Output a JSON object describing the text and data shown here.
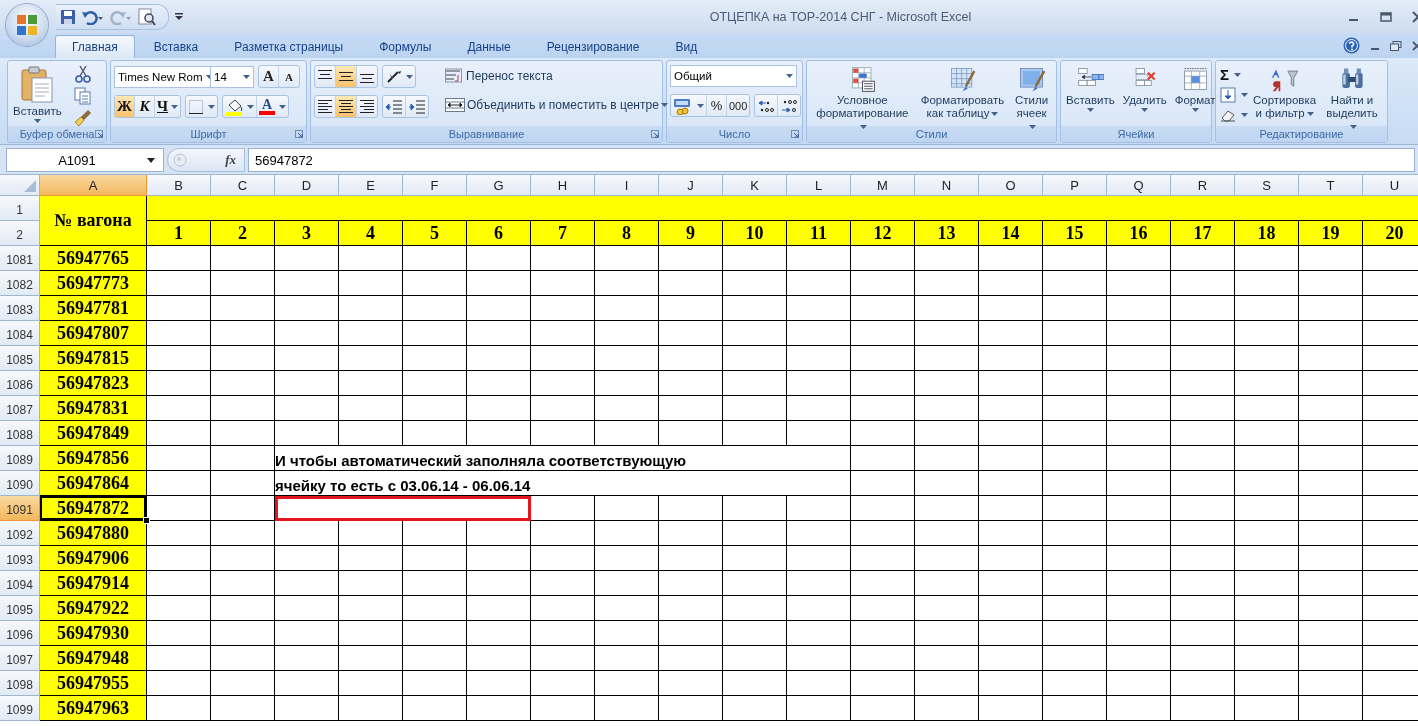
{
  "window": {
    "title": "ОТЦЕПКА на ТОР-2014 СНГ - Microsoft Excel"
  },
  "tabs": [
    {
      "label": "Главная",
      "selected": true
    },
    {
      "label": "Вставка",
      "selected": false
    },
    {
      "label": "Разметка страницы",
      "selected": false
    },
    {
      "label": "Формулы",
      "selected": false
    },
    {
      "label": "Данные",
      "selected": false
    },
    {
      "label": "Рецензирование",
      "selected": false
    },
    {
      "label": "Вид",
      "selected": false
    }
  ],
  "ribbon": {
    "groups": [
      {
        "kind": "clipboard",
        "label": "Буфер обмена",
        "paste": "Вставить"
      },
      {
        "kind": "font",
        "label": "Шрифт",
        "font_name": "Times New Rom",
        "font_size": "14",
        "grow": "A",
        "shrink": "A",
        "font_color_letter": "A",
        "styles": [
          {
            "kind": "bold",
            "text": "Ж",
            "pressed": true
          },
          {
            "kind": "italic",
            "text": "К",
            "pressed": false
          },
          {
            "kind": "underline",
            "text": "Ч",
            "pressed": false
          }
        ]
      },
      {
        "kind": "alignment",
        "label": "Выравнивание",
        "wrap_text": "Перенос текста",
        "merge": "Объединить и поместить в центре",
        "vertical": [
          {
            "kind": "top",
            "pressed": false
          },
          {
            "kind": "middle",
            "pressed": true
          },
          {
            "kind": "bottom",
            "pressed": false
          }
        ],
        "horizontal": [
          {
            "kind": "left",
            "pressed": false
          },
          {
            "kind": "center",
            "pressed": true
          },
          {
            "kind": "right",
            "pressed": false
          }
        ]
      },
      {
        "kind": "number",
        "label": "Число",
        "format": "Общий",
        "percent": "%",
        "thousands": "000"
      },
      {
        "kind": "styles",
        "label": "Стили",
        "buttons": [
          {
            "kind": "conditional",
            "label": "Условное\nформатирование"
          },
          {
            "kind": "table",
            "label": "Форматировать\nкак таблицу"
          },
          {
            "kind": "cell",
            "label": "Стили\nячеек"
          }
        ]
      },
      {
        "kind": "cells",
        "label": "Ячейки",
        "buttons": [
          {
            "kind": "insert",
            "label": "Вставить"
          },
          {
            "kind": "delete",
            "label": "Удалить"
          },
          {
            "kind": "format",
            "label": "Формат"
          }
        ]
      },
      {
        "kind": "editing",
        "label": "Редактирование",
        "autosum": "Σ",
        "buttons": [
          {
            "kind": "sort",
            "label": "Сортировка\nи фильтр"
          },
          {
            "kind": "find",
            "label": "Найти и\nвыделить"
          }
        ]
      }
    ]
  },
  "formula_bar": {
    "name_box": "A1091",
    "function_button": "fx",
    "value": "56947872"
  },
  "sheet": {
    "columns": [
      {
        "label": "A",
        "selected": true
      },
      {
        "label": "B",
        "selected": false
      },
      {
        "label": "C",
        "selected": false
      },
      {
        "label": "D",
        "selected": false
      },
      {
        "label": "E",
        "selected": false
      },
      {
        "label": "F",
        "selected": false
      },
      {
        "label": "G",
        "selected": false
      },
      {
        "label": "H",
        "selected": false
      },
      {
        "label": "I",
        "selected": false
      },
      {
        "label": "J",
        "selected": false
      },
      {
        "label": "K",
        "selected": false
      },
      {
        "label": "L",
        "selected": false
      },
      {
        "label": "M",
        "selected": false
      },
      {
        "label": "N",
        "selected": false
      },
      {
        "label": "O",
        "selected": false
      },
      {
        "label": "P",
        "selected": false
      },
      {
        "label": "Q",
        "selected": false
      },
      {
        "label": "R",
        "selected": false
      },
      {
        "label": "S",
        "selected": false
      },
      {
        "label": "T",
        "selected": false
      },
      {
        "label": "U",
        "selected": false
      }
    ],
    "header": {
      "row_numbers": [
        "1",
        "2"
      ],
      "title": "№ вагона",
      "days": [
        "1",
        "2",
        "3",
        "4",
        "5",
        "6",
        "7",
        "8",
        "9",
        "10",
        "11",
        "12",
        "13",
        "14",
        "15",
        "16",
        "17",
        "18",
        "19",
        "20"
      ]
    },
    "rows": [
      {
        "number": "1081",
        "wagon": "56947765",
        "selected": false
      },
      {
        "number": "1082",
        "wagon": "56947773",
        "selected": false
      },
      {
        "number": "1083",
        "wagon": "56947781",
        "selected": false
      },
      {
        "number": "1084",
        "wagon": "56947807",
        "selected": false
      },
      {
        "number": "1085",
        "wagon": "56947815",
        "selected": false
      },
      {
        "number": "1086",
        "wagon": "56947823",
        "selected": false
      },
      {
        "number": "1087",
        "wagon": "56947831",
        "selected": false
      },
      {
        "number": "1088",
        "wagon": "56947849",
        "selected": false
      },
      {
        "number": "1089",
        "wagon": "56947856",
        "selected": false,
        "note": "И чтобы автоматический заполняла соответствующую"
      },
      {
        "number": "1090",
        "wagon": "56947864",
        "selected": false,
        "note": "ячейку то есть с 03.06.14 - 06.06.14"
      },
      {
        "number": "1091",
        "wagon": "56947872",
        "selected": true,
        "marked": true
      },
      {
        "number": "1092",
        "wagon": "56947880",
        "selected": false
      },
      {
        "number": "1093",
        "wagon": "56947906",
        "selected": false
      },
      {
        "number": "1094",
        "wagon": "56947914",
        "selected": false
      },
      {
        "number": "1095",
        "wagon": "56947922",
        "selected": false
      },
      {
        "number": "1096",
        "wagon": "56947930",
        "selected": false
      },
      {
        "number": "1097",
        "wagon": "56947948",
        "selected": false
      },
      {
        "number": "1098",
        "wagon": "56947955",
        "selected": false
      },
      {
        "number": "1099",
        "wagon": "56947963",
        "selected": false
      }
    ]
  }
}
